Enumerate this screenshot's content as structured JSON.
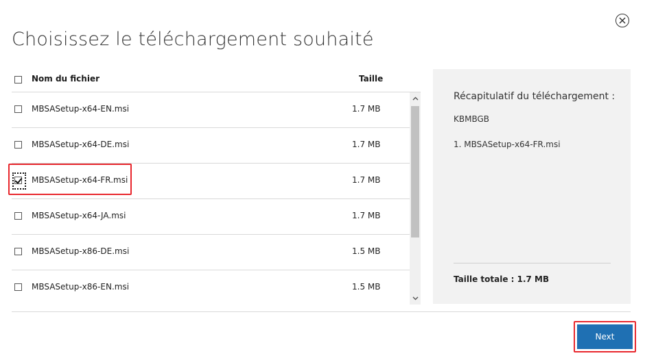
{
  "dialog": {
    "title": "Choisissez le téléchargement souhaité"
  },
  "table": {
    "header": {
      "name": "Nom du fichier",
      "size": "Taille"
    },
    "rows": [
      {
        "name": "MBSASetup-x64-EN.msi",
        "size": "1.7 MB",
        "checked": false
      },
      {
        "name": "MBSASetup-x64-DE.msi",
        "size": "1.7 MB",
        "checked": false
      },
      {
        "name": "MBSASetup-x64-FR.msi",
        "size": "1.7 MB",
        "checked": true
      },
      {
        "name": "MBSASetup-x64-JA.msi",
        "size": "1.7 MB",
        "checked": false
      },
      {
        "name": "MBSASetup-x86-DE.msi",
        "size": "1.5 MB",
        "checked": false
      },
      {
        "name": "MBSASetup-x86-EN.msi",
        "size": "1.5 MB",
        "checked": false
      }
    ]
  },
  "summary": {
    "title": "Récapitulatif du téléchargement :",
    "subtitle": "KBMBGB",
    "items": [
      "1. MBSASetup-x64-FR.msi"
    ],
    "total": "Taille totale : 1.7 MB"
  },
  "footer": {
    "next_label": "Next"
  },
  "colors": {
    "accent": "#1f70b3",
    "highlight": "#e8262c",
    "panel": "#f2f2f2"
  }
}
